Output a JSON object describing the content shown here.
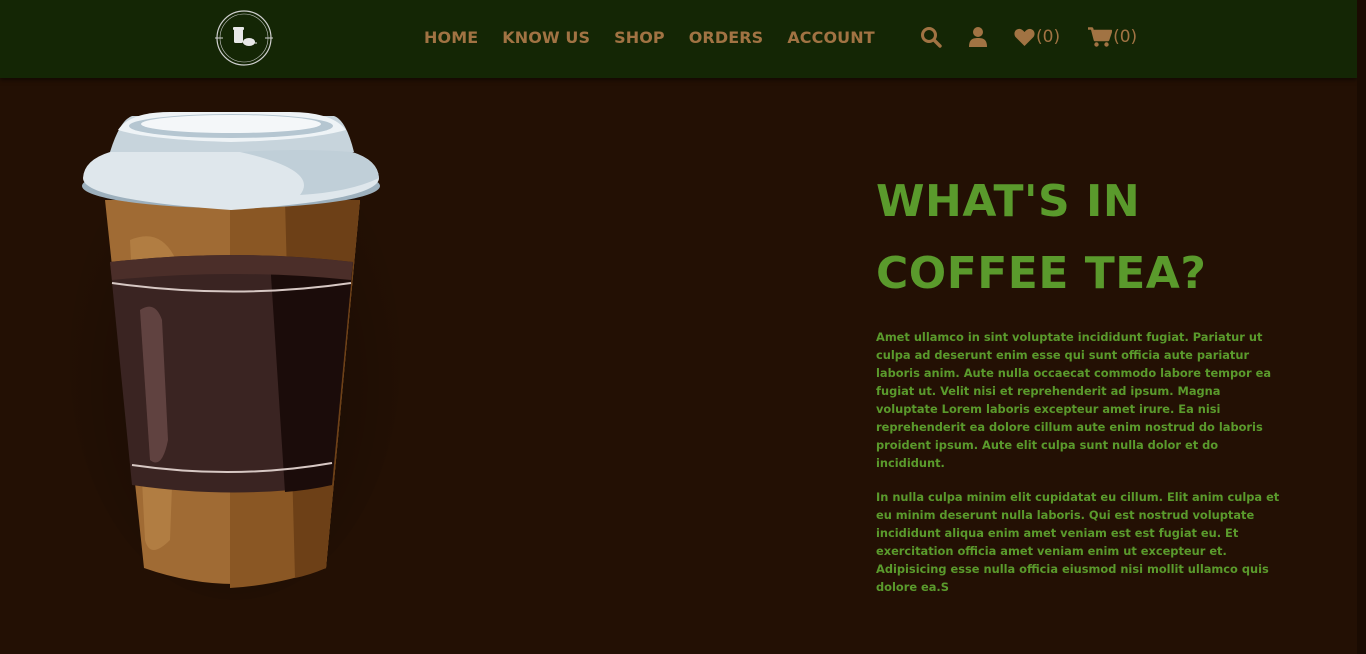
{
  "brand": {
    "logo_text_top": "COFFEE TEA",
    "logo_text_bottom": "2022"
  },
  "nav": {
    "links": [
      "HOME",
      "KNOW US",
      "SHOP",
      "ORDERS",
      "ACCOUNT"
    ],
    "wishlist_count": "(0)",
    "cart_count": "(0)",
    "icons": [
      "search-icon",
      "user-icon",
      "heart-icon",
      "cart-icon"
    ]
  },
  "hero": {
    "title_line1": "WHAT'S IN",
    "title_line2": "COFFEE TEA?",
    "paragraph1": "Amet ullamco in sint voluptate incididunt fugiat. Pariatur ut culpa ad deserunt enim esse qui sunt officia aute pariatur laboris anim. Aute nulla occaecat commodo labore tempor ea fugiat ut. Velit nisi et reprehenderit ad ipsum. Magna voluptate Lorem laboris excepteur amet irure. Ea nisi reprehenderit ea dolore cillum aute enim nostrud do laboris proident ipsum. Aute elit culpa sunt nulla dolor et do incididunt.",
    "paragraph2": "In nulla culpa minim elit cupidatat eu cillum. Elit anim culpa et eu minim deserunt nulla laboris. Qui est nostrud voluptate incididunt aliqua enim amet veniam est est fugiat eu. Et exercitation officia amet veniam enim ut excepteur et. Adipisicing esse nulla officia eiusmod nisi mollit ullamco quis dolore ea.S"
  },
  "colors": {
    "nav_bg": "#142605",
    "page_bg": "#231004",
    "accent_green": "#5a9a2c",
    "nav_text": "#a17343"
  }
}
